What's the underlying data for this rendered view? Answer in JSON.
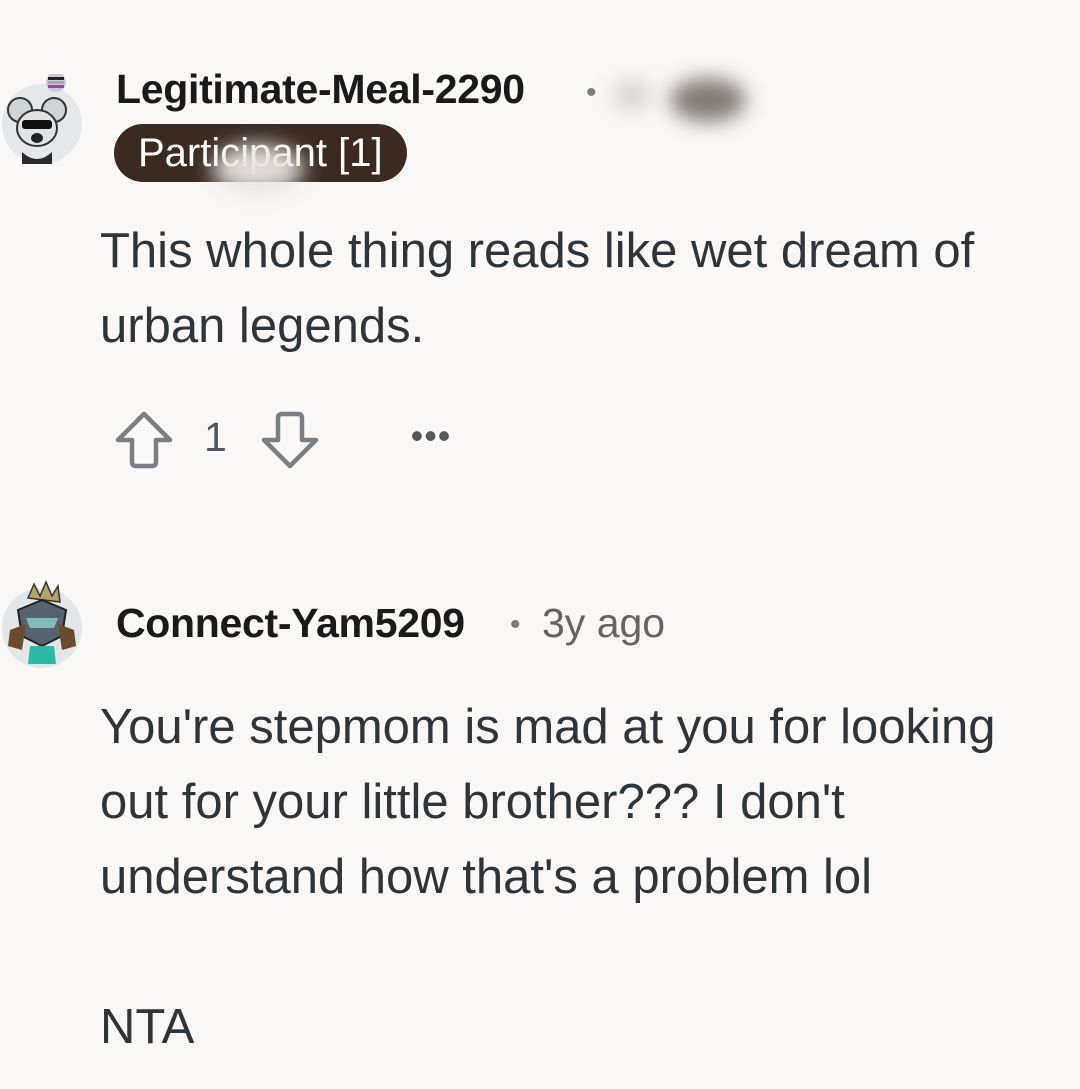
{
  "comments": [
    {
      "username": "Legitimate-Meal-2290",
      "separator": "•",
      "flair": "Participant [1]",
      "body": "This whole thing reads like wet dream of urban legends.",
      "score": "1",
      "more_label": "•••",
      "avatar_icon": "koala-avatar-icon"
    },
    {
      "username": "Connect-Yam5209",
      "separator": "•",
      "timestamp": "3y ago",
      "body": "You're stepmom is mad at you for looking out for your little brother??? I don't understand how that's a problem lol\n\nNTA",
      "avatar_icon": "knight-avatar-icon"
    }
  ],
  "colors": {
    "background": "#f9f8f6",
    "flair_bg": "#3a2a22",
    "username": "#1a1a1b",
    "body_text": "#2f3438",
    "meta_text": "#6b625a"
  }
}
